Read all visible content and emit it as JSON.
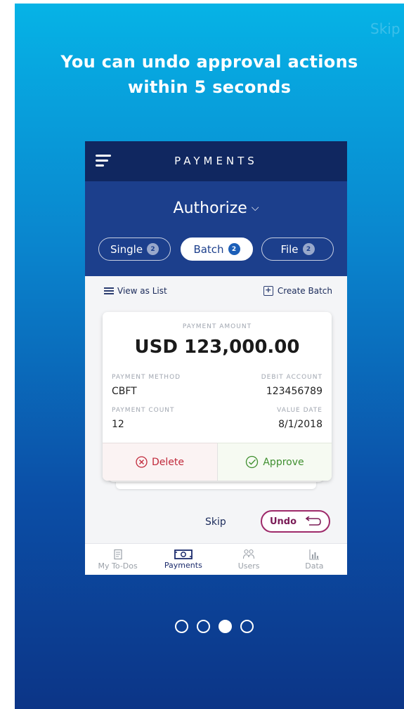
{
  "skip_top_label": "Skip",
  "headline": "You can undo approval actions within 5 seconds",
  "app": {
    "title": "PAYMENTS",
    "authorize_label": "Authorize",
    "segments": [
      {
        "label": "Single",
        "count": "2"
      },
      {
        "label": "Batch",
        "count": "2"
      },
      {
        "label": "File",
        "count": "2"
      }
    ],
    "view_as_list": "View as List",
    "create_batch": "Create Batch"
  },
  "card": {
    "amount_label": "PAYMENT AMOUNT",
    "amount": "USD 123,000.00",
    "payment_method_label": "PAYMENT METHOD",
    "payment_method": "CBFT",
    "debit_account_label": "DEBIT ACCOUNT",
    "debit_account": "123456789",
    "payment_count_label": "PAYMENT COUNT",
    "payment_count": "12",
    "value_date_label": "VALUE DATE",
    "value_date": "8/1/2018",
    "delete_label": "Delete",
    "approve_label": "Approve"
  },
  "actions": {
    "skip_label": "Skip",
    "undo_label": "Undo"
  },
  "tabs": [
    {
      "label": "My To-Dos",
      "icon": "todo-icon"
    },
    {
      "label": "Payments",
      "icon": "payments-icon"
    },
    {
      "label": "Users",
      "icon": "users-icon"
    },
    {
      "label": "Data",
      "icon": "data-icon"
    }
  ],
  "pager": {
    "current": 3,
    "total": 4
  },
  "colors": {
    "header_navy": "#102760",
    "band_blue": "#1c3f8c",
    "delete_red": "#c0283a",
    "approve_green": "#3f8f2f",
    "undo_magenta": "#9e2a6a"
  }
}
